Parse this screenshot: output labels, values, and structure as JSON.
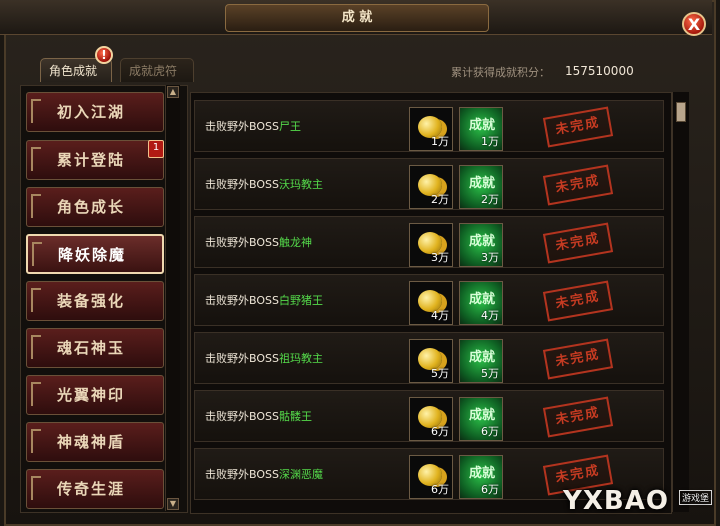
{
  "window": {
    "title": "成 就",
    "close_label": "X"
  },
  "tabs": [
    {
      "label": "角色成就",
      "active": true
    },
    {
      "label": "成就虎符",
      "active": false
    }
  ],
  "alert_mark": "!",
  "score": {
    "label": "累计获得成就积分：",
    "value": "157510000"
  },
  "categories": [
    {
      "label": "初入江湖",
      "active": false
    },
    {
      "label": "累计登陆",
      "active": false,
      "badge": "1"
    },
    {
      "label": "角色成长",
      "active": false
    },
    {
      "label": "降妖除魔",
      "active": true
    },
    {
      "label": "装备强化",
      "active": false
    },
    {
      "label": "魂石神玉",
      "active": false
    },
    {
      "label": "光翼神印",
      "active": false
    },
    {
      "label": "神魂神盾",
      "active": false
    },
    {
      "label": "传奇生涯",
      "active": false
    }
  ],
  "achievements": [
    {
      "prefix": "击败野外BOSS",
      "boss": "尸王",
      "gold_qty": "1万",
      "ach_label": "成就",
      "ach_qty": "1万",
      "status": "未完成"
    },
    {
      "prefix": "击败野外BOSS",
      "boss": "沃玛教主",
      "gold_qty": "2万",
      "ach_label": "成就",
      "ach_qty": "2万",
      "status": "未完成"
    },
    {
      "prefix": "击败野外BOSS",
      "boss": "触龙神",
      "gold_qty": "3万",
      "ach_label": "成就",
      "ach_qty": "3万",
      "status": "未完成"
    },
    {
      "prefix": "击败野外BOSS",
      "boss": "白野猪王",
      "gold_qty": "4万",
      "ach_label": "成就",
      "ach_qty": "4万",
      "status": "未完成"
    },
    {
      "prefix": "击败野外BOSS",
      "boss": "祖玛教主",
      "gold_qty": "5万",
      "ach_label": "成就",
      "ach_qty": "5万",
      "status": "未完成"
    },
    {
      "prefix": "击败野外BOSS",
      "boss": "骷髅王",
      "gold_qty": "6万",
      "ach_label": "成就",
      "ach_qty": "6万",
      "status": "未完成"
    },
    {
      "prefix": "击败野外BOSS",
      "boss": "深渊恶魔",
      "gold_qty": "6万",
      "ach_label": "成就",
      "ach_qty": "6万",
      "status": "未完成"
    }
  ],
  "watermark": {
    "main": "YXBAO",
    "small": "游戏堡"
  },
  "colors": {
    "boss_name": "#54d94a",
    "stamp": "#c63b22",
    "active_border": "#f0d9b0"
  }
}
